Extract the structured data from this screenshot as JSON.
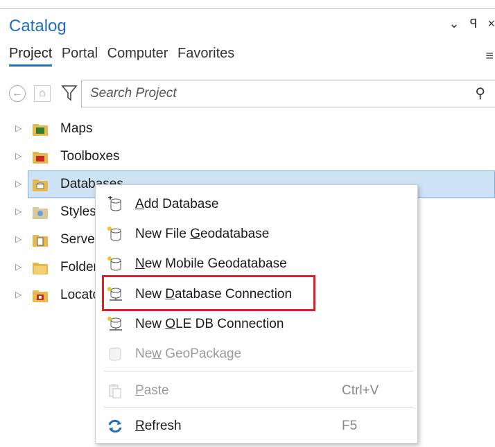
{
  "pane": {
    "title": "Catalog",
    "controls": {
      "collapse": "⌄",
      "pin": "ᵖ",
      "close": "×"
    }
  },
  "tabs": [
    {
      "label": "Project",
      "active": true
    },
    {
      "label": "Portal",
      "active": false
    },
    {
      "label": "Computer",
      "active": false
    },
    {
      "label": "Favorites",
      "active": false
    }
  ],
  "search": {
    "placeholder": "Search Project",
    "value": ""
  },
  "tree": {
    "items": [
      {
        "label": "Maps",
        "icon": "folder-maps-icon"
      },
      {
        "label": "Toolboxes",
        "icon": "folder-toolboxes-icon"
      },
      {
        "label": "Databases",
        "icon": "folder-databases-icon"
      },
      {
        "label": "Styles",
        "icon": "folder-styles-icon"
      },
      {
        "label": "Servers",
        "icon": "folder-servers-icon"
      },
      {
        "label": "Folders",
        "icon": "folder-folders-icon"
      },
      {
        "label": "Locators",
        "icon": "folder-locators-icon"
      }
    ]
  },
  "context_menu": {
    "items": [
      {
        "pre": "",
        "accel": "A",
        "post": "dd Database",
        "shortcut": "",
        "disabled": false
      },
      {
        "pre": "New File ",
        "accel": "G",
        "post": "eodatabase",
        "shortcut": "",
        "disabled": false
      },
      {
        "pre": "",
        "accel": "N",
        "post": "ew Mobile Geodatabase",
        "shortcut": "",
        "disabled": false
      },
      {
        "pre": "New ",
        "accel": "D",
        "post": "atabase Connection",
        "shortcut": "",
        "disabled": false
      },
      {
        "pre": "New ",
        "accel": "O",
        "post": "LE DB Connection",
        "shortcut": "",
        "disabled": false
      },
      {
        "pre": "Ne",
        "accel": "w",
        "post": " GeoPackage",
        "shortcut": "",
        "disabled": true
      },
      {
        "pre": "",
        "accel": "P",
        "post": "aste",
        "shortcut": "Ctrl+V",
        "disabled": true
      },
      {
        "pre": "",
        "accel": "R",
        "post": "efresh",
        "shortcut": "F5",
        "disabled": false
      }
    ]
  },
  "colors": {
    "accent": "#1f6fbf",
    "selection": "#cfe3f7",
    "highlight_box": "#d9202b",
    "folder": "#e8b84a"
  }
}
